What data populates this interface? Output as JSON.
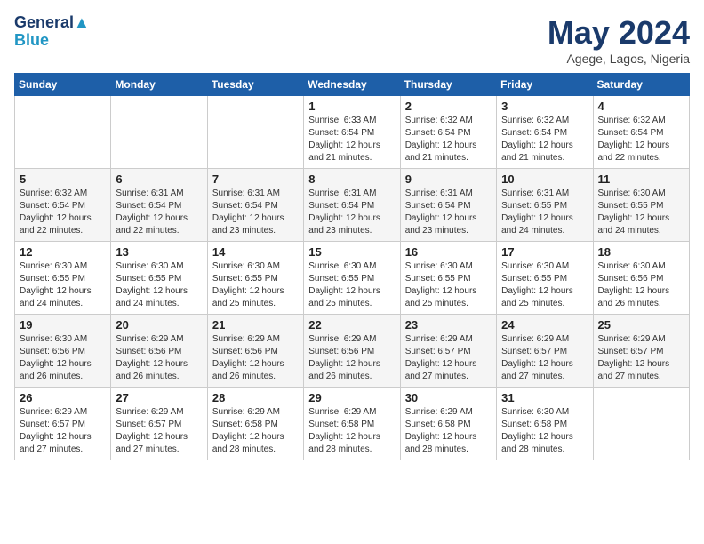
{
  "header": {
    "logo_line1": "General",
    "logo_line2": "Blue",
    "month_year": "May 2024",
    "location": "Agege, Lagos, Nigeria"
  },
  "weekdays": [
    "Sunday",
    "Monday",
    "Tuesday",
    "Wednesday",
    "Thursday",
    "Friday",
    "Saturday"
  ],
  "weeks": [
    [
      {
        "day": "",
        "info": ""
      },
      {
        "day": "",
        "info": ""
      },
      {
        "day": "",
        "info": ""
      },
      {
        "day": "1",
        "info": "Sunrise: 6:33 AM\nSunset: 6:54 PM\nDaylight: 12 hours\nand 21 minutes."
      },
      {
        "day": "2",
        "info": "Sunrise: 6:32 AM\nSunset: 6:54 PM\nDaylight: 12 hours\nand 21 minutes."
      },
      {
        "day": "3",
        "info": "Sunrise: 6:32 AM\nSunset: 6:54 PM\nDaylight: 12 hours\nand 21 minutes."
      },
      {
        "day": "4",
        "info": "Sunrise: 6:32 AM\nSunset: 6:54 PM\nDaylight: 12 hours\nand 22 minutes."
      }
    ],
    [
      {
        "day": "5",
        "info": "Sunrise: 6:32 AM\nSunset: 6:54 PM\nDaylight: 12 hours\nand 22 minutes."
      },
      {
        "day": "6",
        "info": "Sunrise: 6:31 AM\nSunset: 6:54 PM\nDaylight: 12 hours\nand 22 minutes."
      },
      {
        "day": "7",
        "info": "Sunrise: 6:31 AM\nSunset: 6:54 PM\nDaylight: 12 hours\nand 23 minutes."
      },
      {
        "day": "8",
        "info": "Sunrise: 6:31 AM\nSunset: 6:54 PM\nDaylight: 12 hours\nand 23 minutes."
      },
      {
        "day": "9",
        "info": "Sunrise: 6:31 AM\nSunset: 6:54 PM\nDaylight: 12 hours\nand 23 minutes."
      },
      {
        "day": "10",
        "info": "Sunrise: 6:31 AM\nSunset: 6:55 PM\nDaylight: 12 hours\nand 24 minutes."
      },
      {
        "day": "11",
        "info": "Sunrise: 6:30 AM\nSunset: 6:55 PM\nDaylight: 12 hours\nand 24 minutes."
      }
    ],
    [
      {
        "day": "12",
        "info": "Sunrise: 6:30 AM\nSunset: 6:55 PM\nDaylight: 12 hours\nand 24 minutes."
      },
      {
        "day": "13",
        "info": "Sunrise: 6:30 AM\nSunset: 6:55 PM\nDaylight: 12 hours\nand 24 minutes."
      },
      {
        "day": "14",
        "info": "Sunrise: 6:30 AM\nSunset: 6:55 PM\nDaylight: 12 hours\nand 25 minutes."
      },
      {
        "day": "15",
        "info": "Sunrise: 6:30 AM\nSunset: 6:55 PM\nDaylight: 12 hours\nand 25 minutes."
      },
      {
        "day": "16",
        "info": "Sunrise: 6:30 AM\nSunset: 6:55 PM\nDaylight: 12 hours\nand 25 minutes."
      },
      {
        "day": "17",
        "info": "Sunrise: 6:30 AM\nSunset: 6:55 PM\nDaylight: 12 hours\nand 25 minutes."
      },
      {
        "day": "18",
        "info": "Sunrise: 6:30 AM\nSunset: 6:56 PM\nDaylight: 12 hours\nand 26 minutes."
      }
    ],
    [
      {
        "day": "19",
        "info": "Sunrise: 6:30 AM\nSunset: 6:56 PM\nDaylight: 12 hours\nand 26 minutes."
      },
      {
        "day": "20",
        "info": "Sunrise: 6:29 AM\nSunset: 6:56 PM\nDaylight: 12 hours\nand 26 minutes."
      },
      {
        "day": "21",
        "info": "Sunrise: 6:29 AM\nSunset: 6:56 PM\nDaylight: 12 hours\nand 26 minutes."
      },
      {
        "day": "22",
        "info": "Sunrise: 6:29 AM\nSunset: 6:56 PM\nDaylight: 12 hours\nand 26 minutes."
      },
      {
        "day": "23",
        "info": "Sunrise: 6:29 AM\nSunset: 6:57 PM\nDaylight: 12 hours\nand 27 minutes."
      },
      {
        "day": "24",
        "info": "Sunrise: 6:29 AM\nSunset: 6:57 PM\nDaylight: 12 hours\nand 27 minutes."
      },
      {
        "day": "25",
        "info": "Sunrise: 6:29 AM\nSunset: 6:57 PM\nDaylight: 12 hours\nand 27 minutes."
      }
    ],
    [
      {
        "day": "26",
        "info": "Sunrise: 6:29 AM\nSunset: 6:57 PM\nDaylight: 12 hours\nand 27 minutes."
      },
      {
        "day": "27",
        "info": "Sunrise: 6:29 AM\nSunset: 6:57 PM\nDaylight: 12 hours\nand 27 minutes."
      },
      {
        "day": "28",
        "info": "Sunrise: 6:29 AM\nSunset: 6:58 PM\nDaylight: 12 hours\nand 28 minutes."
      },
      {
        "day": "29",
        "info": "Sunrise: 6:29 AM\nSunset: 6:58 PM\nDaylight: 12 hours\nand 28 minutes."
      },
      {
        "day": "30",
        "info": "Sunrise: 6:29 AM\nSunset: 6:58 PM\nDaylight: 12 hours\nand 28 minutes."
      },
      {
        "day": "31",
        "info": "Sunrise: 6:30 AM\nSunset: 6:58 PM\nDaylight: 12 hours\nand 28 minutes."
      },
      {
        "day": "",
        "info": ""
      }
    ]
  ]
}
